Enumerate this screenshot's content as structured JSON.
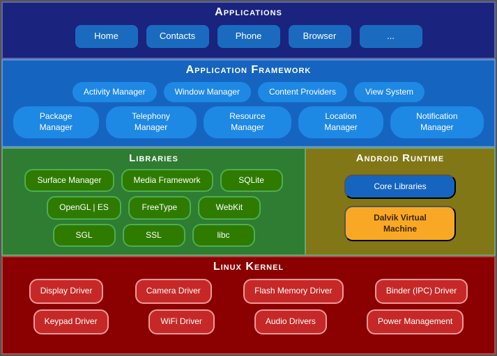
{
  "applications": {
    "title": "Applications",
    "buttons": [
      {
        "label": "Home",
        "id": "home"
      },
      {
        "label": "Contacts",
        "id": "contacts"
      },
      {
        "label": "Phone",
        "id": "phone"
      },
      {
        "label": "Browser",
        "id": "browser"
      },
      {
        "label": "...",
        "id": "more"
      }
    ]
  },
  "framework": {
    "title": "Application Framework",
    "row1": [
      {
        "label": "Activity Manager"
      },
      {
        "label": "Window\nManager"
      },
      {
        "label": "Content\nProviders"
      },
      {
        "label": "View\nSystem"
      }
    ],
    "row2": [
      {
        "label": "Package Manager"
      },
      {
        "label": "Telephony\nManager"
      },
      {
        "label": "Resource\nManager"
      },
      {
        "label": "Location\nManager"
      },
      {
        "label": "Notification\nManager"
      }
    ]
  },
  "libraries": {
    "title": "Libraries",
    "row1": [
      {
        "label": "Surface Manager"
      },
      {
        "label": "Media\nFramework"
      },
      {
        "label": "SQLite"
      }
    ],
    "row2": [
      {
        "label": "OpenGL | ES"
      },
      {
        "label": "FreeType"
      },
      {
        "label": "WebKit"
      }
    ],
    "row3": [
      {
        "label": "SGL"
      },
      {
        "label": "SSL"
      },
      {
        "label": "libc"
      }
    ]
  },
  "runtime": {
    "title": "Android Runtime",
    "core": "Core Libraries",
    "dalvik": "Dalvik Virtual\nMachine"
  },
  "kernel": {
    "title": "Linux Kernel",
    "row1": [
      {
        "label": "Display\nDriver"
      },
      {
        "label": "Camera Driver"
      },
      {
        "label": "Flash Memory\nDriver"
      },
      {
        "label": "Binder (IPC)\nDriver"
      }
    ],
    "row2": [
      {
        "label": "Keypad Driver"
      },
      {
        "label": "WiFi Driver"
      },
      {
        "label": "Audio\nDrivers"
      },
      {
        "label": "Power\nManagement"
      }
    ]
  }
}
